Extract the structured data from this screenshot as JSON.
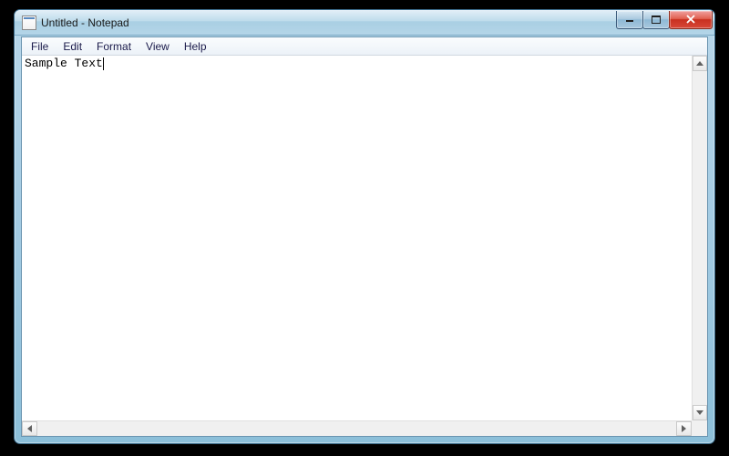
{
  "titlebar": {
    "title": "Untitled - Notepad"
  },
  "menu": {
    "items": [
      "File",
      "Edit",
      "Format",
      "View",
      "Help"
    ]
  },
  "editor": {
    "content": "Sample Text"
  }
}
